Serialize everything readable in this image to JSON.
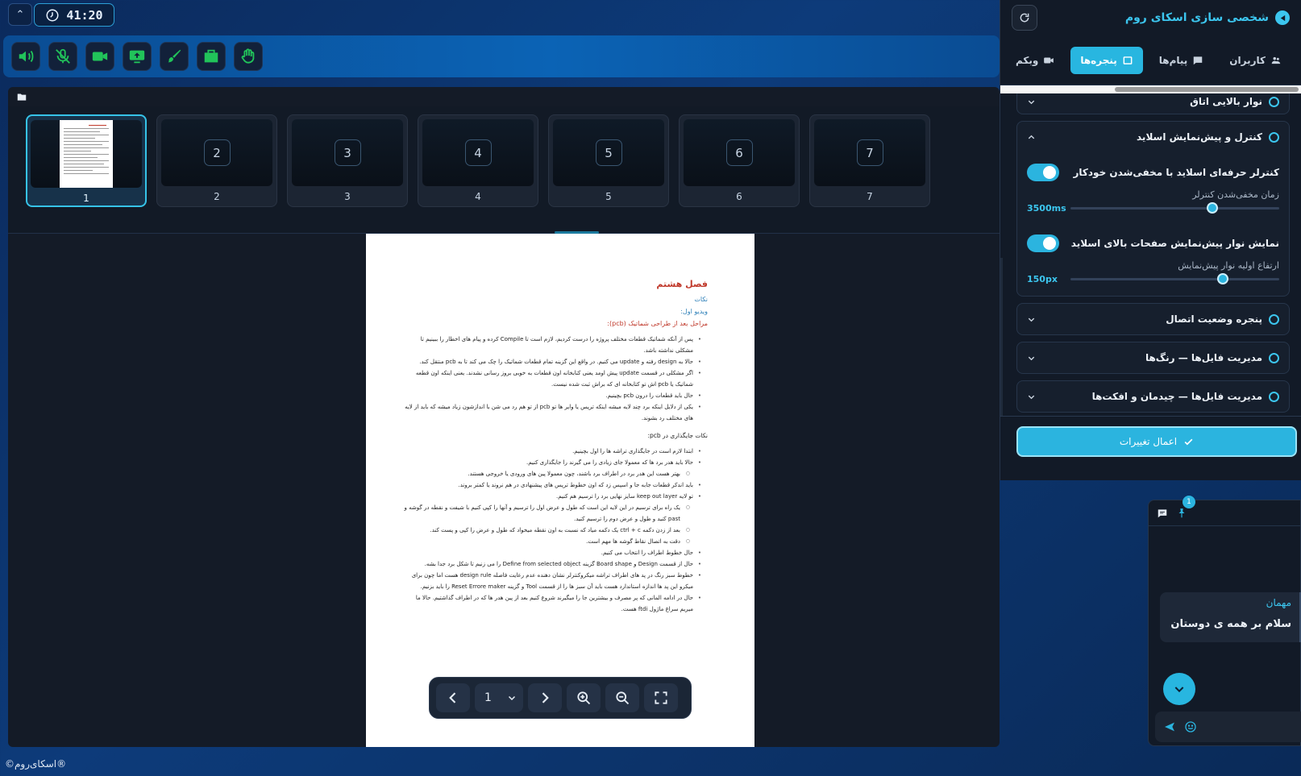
{
  "timer": "41:20",
  "footer": "©اسکای‌روم®",
  "toolbar": {
    "buttons": [
      "speaker-icon",
      "mic-off-icon",
      "camera-icon",
      "screen-share-icon",
      "brush-icon",
      "files-icon",
      "hand-raise-icon"
    ],
    "accent": "#21c45a"
  },
  "thumbnails": [
    {
      "label": "1",
      "active": true
    },
    {
      "label": "2",
      "number": "2"
    },
    {
      "label": "3",
      "number": "3"
    },
    {
      "label": "4",
      "number": "4"
    },
    {
      "label": "5",
      "number": "5"
    },
    {
      "label": "6",
      "number": "6"
    },
    {
      "label": "7",
      "number": "7"
    }
  ],
  "document": {
    "heading": "فصل هشتم",
    "line_blue_1": "نکات",
    "line_blue_2": "ویدیو اول:",
    "line_red": "مراحل بعد از طراحی شماتیک (pcb):",
    "bullets_a": [
      "پس از آنکه شماتیک قطعات مختلف پروژه را درست کردیم، لازم است تا Compile کرده و پیام های اخطار را ببینیم تا مشکلی نداشته باشد.",
      "حالا به design رفته و update می کنیم. در واقع این گزینه تمام قطعات شماتیک را چک می کند تا به pcb منتقل کند.",
      "اگر مشکلی در قسمت update پیش اومد یعنی کتابخانه اون قطعات به خوبی بروز رسانی نشدند. یعنی اینکه اون قطعه شماتیک یا pcb اش تو کتابخانه ای که براش ثبت شده نیست.",
      "حال باید قطعات را درون pcb بچینیم.",
      "یکی از دلایل اینکه برد چند لایه میشه اینکه ترپس یا وایر ها تو pcb از تو هم رد می شن با اندازشون زیاد میشه که باید از لایه های مختلف رد بشوند."
    ],
    "subheading": "نکات جایگذاری در pcb:",
    "bullets_b": [
      {
        "text": "ابتدا لازم است در جایگذاری تراشه ها را اول بچینیم.",
        "level": 1
      },
      {
        "text": "حالا باید هدر برد ها که معمولا جای زیادی را می گیرند را جایگذاری کنیم.",
        "level": 1
      },
      {
        "text": "بهتر هست این هدر برد در اطراف برد باشند، چون معمولا پین های ورودی یا خروجی هستند.",
        "level": 2
      },
      {
        "text": "باید اندکر قطعات جابه جا و اسپس زد که اون خطوط ترپس های پیشنهادی در هم نروند یا کمتر بروند.",
        "level": 1
      },
      {
        "text": "تو لایه keep out layer سایز نهایی برد را ترسیم هم کنیم.",
        "level": 1
      },
      {
        "text": "یک راه برای ترسیم در این لایه این است که طول و عرض اول را ترسیم و آنها را کپی کنیم با شیفت و نقطه در گوشه و past کنید و طول و عرض دوم را ترسیم کنید.",
        "level": 2
      },
      {
        "text": "بعد از زدن دکمه ctrl + c یک دکمه میاد که نسبت به اون نقطه میخواد که طول و عرض را کپی و پست کند.",
        "level": 2
      },
      {
        "text": "دقت به اتصال نقاط گوشه ها مهم است.",
        "level": 2
      },
      {
        "text": "حال خطوط اطراف را انتخاب می کنیم.",
        "level": 1
      },
      {
        "text": "حال از قسمت Design و Board shape گزینه Define from selected object را می زنیم تا شکل برد جدا بشه.",
        "level": 1
      },
      {
        "text": "خطوط سبز رنگ در پد های اطراف تراشه میکروکنترلر نشان دهنده عدم رعایت فاصله design rule هست اما چون برای میکرو این پد ها اندازه استاندارد هست باید آن سبز ها را از قسمت Tool و گزینه Reset Errore maker را باید بزنیم.",
        "level": 1
      },
      {
        "text": "حال در ادامه المانی که پر مصرف و بیشترین جا را میگیرند شروع کنیم بعد از پین هدر ها که در اطراف گذاشتیم. حالا ما میریم سراغ ماژول ftdi هست.",
        "level": 1
      }
    ]
  },
  "doc_controls": {
    "page_value": "1",
    "buttons": [
      "prev-icon",
      "next-icon",
      "zoom-in-icon",
      "zoom-out-icon",
      "fullscreen-icon"
    ]
  },
  "panel": {
    "title": "شخصی سازی اسکای روم",
    "tabs": [
      {
        "label": "کاربران",
        "icon": "users-icon"
      },
      {
        "label": "پیام‌ها",
        "icon": "message-icon"
      },
      {
        "label": "پنجره‌ها",
        "icon": "window-icon",
        "active": true
      },
      {
        "label": "وبکم",
        "icon": "webcam-icon"
      },
      {
        "label": "",
        "icon": "wrench-icon"
      }
    ],
    "sections": {
      "top_bar": "نوار بالایی اتاق",
      "slide_control": "کنترل و پیش‌نمایش اسلاید",
      "connection": "پنجره وضعیت اتصال",
      "files_colors": "مدیریت فایل‌ها — رنگ‌ها",
      "files_layout": "مدیریت فایل‌ها — چیدمان و افکت‌ها"
    },
    "slide_settings": {
      "pro_control_label": "کنترلر حرفه‌ای اسلاید با مخفی‌شدن خودکار",
      "pro_control_on": true,
      "hide_delay_label": "زمان مخفی‌شدن کنترلر",
      "hide_delay_value": "3500ms",
      "hide_delay_fraction": 0.68,
      "preview_bar_label": "نمایش نوار پیش‌نمایش صفحات بالای اسلاید",
      "preview_bar_on": true,
      "preview_height_label": "ارتفاع اولیه نوار پیش‌نمایش",
      "preview_height_value": "150px",
      "preview_height_fraction": 0.73
    },
    "apply_label": "اعمال تغییرات"
  },
  "chat": {
    "pin_badge": "1",
    "sender": "مهمان",
    "message": "سلام بر همه ی دوستان"
  }
}
